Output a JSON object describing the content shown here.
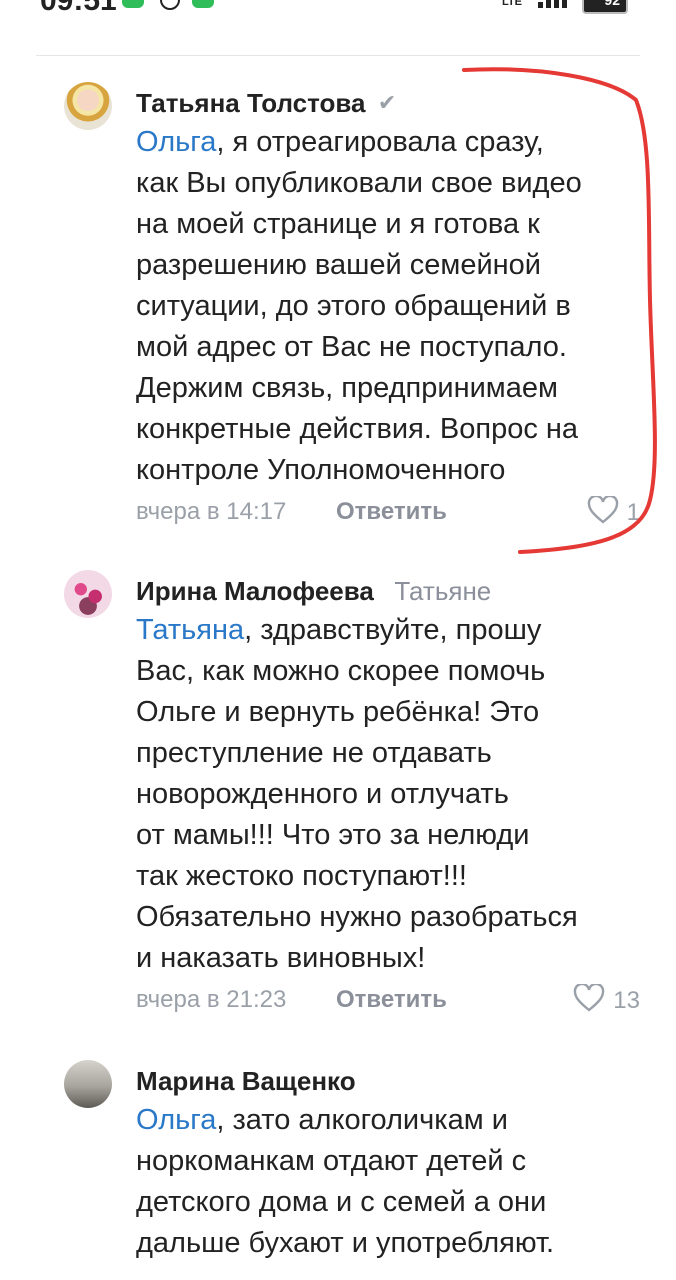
{
  "status_bar": {
    "time": "09:51",
    "network": "LTE",
    "battery": "92"
  },
  "comments": [
    {
      "author": "Татьяна Толстова",
      "verified_icon": "checkmark-icon",
      "reply_to": "",
      "mention": "Ольга",
      "lines": [
        ", я отреагировала сразу,",
        "как Вы опубликовали свое видео",
        "на моей странице и я готова к",
        "разрешению вашей семейной",
        "ситуации, до этого обращений в",
        "мой адрес от Вас не поступало.",
        "Держим связь, предпринимаем",
        "конкретные действия. Вопрос на",
        "контроле Уполномоченного"
      ],
      "time": "вчера в 14:17",
      "reply_label": "Ответить",
      "likes": "1"
    },
    {
      "author": "Ирина Малофеева",
      "reply_to": "Татьяне",
      "mention": "Татьяна",
      "lines": [
        ", здравствуйте, прошу",
        "Вас, как можно скорее помочь",
        "Ольге и вернуть ребёнка! Это",
        "преступление не отдавать",
        "новорожденного и отлучать",
        "от мамы!!! Что это за нелюди",
        "так жестоко поступают!!!",
        "Обязательно нужно разобраться",
        "и наказать виновных!"
      ],
      "time": "вчера в 21:23",
      "reply_label": "Ответить",
      "likes": "13"
    },
    {
      "author": "Марина Ващенко",
      "reply_to": "",
      "mention": "Ольга",
      "lines": [
        ", зато алкоголичкам и",
        "норкоманкам отдают детей с",
        "детского дома и с семей а они",
        "дальше бухают и употребляют."
      ]
    }
  ],
  "icons": {
    "like": "heart-icon"
  },
  "colors": {
    "mention": "#2a78c8",
    "annotation": "#e53935",
    "muted": "#9aa0a8"
  }
}
